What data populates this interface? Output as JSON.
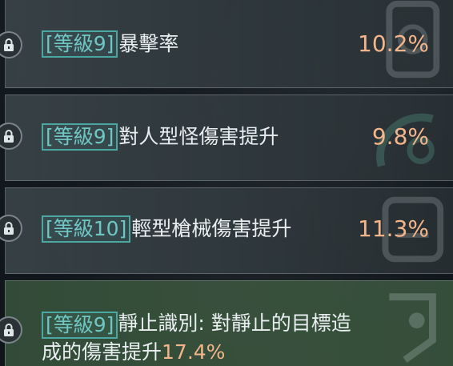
{
  "rows": [
    {
      "tag": "[等級9]",
      "name": "暴擊率",
      "value": "10.2%"
    },
    {
      "tag": "[等級9]",
      "name": "對人型怪傷害提升",
      "value": "9.8%"
    },
    {
      "tag": "[等級10]",
      "name": "輕型槍械傷害提升",
      "value": "11.3%"
    },
    {
      "tag": "[等級9]",
      "name_line1": "靜止識別: 對靜止的目標造",
      "name_line2": "成的傷害提升",
      "value": "17.4%"
    }
  ],
  "icons": {
    "lock": "lock-icon"
  },
  "colors": {
    "tag_text": "#6fc7c3",
    "tag_border": "#4aa7a2",
    "value_text": "#f4b58a",
    "name_text": "#e9eef0",
    "highlight_row_bg": "#3a583e"
  }
}
